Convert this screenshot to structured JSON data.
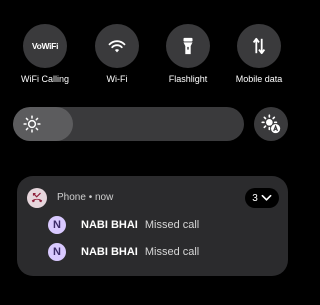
{
  "quick_settings": [
    {
      "id": "wifi-calling",
      "label": "WiFi Calling",
      "icon_text": "VoWiFi",
      "icon": "vowifi-icon"
    },
    {
      "id": "wifi",
      "label": "Wi-Fi",
      "icon": "wifi-icon"
    },
    {
      "id": "flashlight",
      "label": "Flashlight",
      "icon": "flashlight-icon"
    },
    {
      "id": "mobile-data",
      "label": "Mobile data",
      "icon": "mobile-data-icon"
    }
  ],
  "brightness": {
    "level": 0.26,
    "icon": "sun-icon",
    "auto_icon": "auto-brightness-icon"
  },
  "notification": {
    "app_name": "Phone",
    "separator": "•",
    "time": "now",
    "count": "3",
    "app_icon": "missed-call-icon",
    "items": [
      {
        "avatar_letter": "N",
        "caller": "NABI BHAI",
        "status": "Missed call"
      },
      {
        "avatar_letter": "N",
        "caller": "NABI BHAI",
        "status": "Missed call"
      }
    ]
  },
  "colors": {
    "background": "#000000",
    "tile": "#3a3a3c",
    "card": "#2b2b2d",
    "avatar": "#d9c9ff"
  }
}
